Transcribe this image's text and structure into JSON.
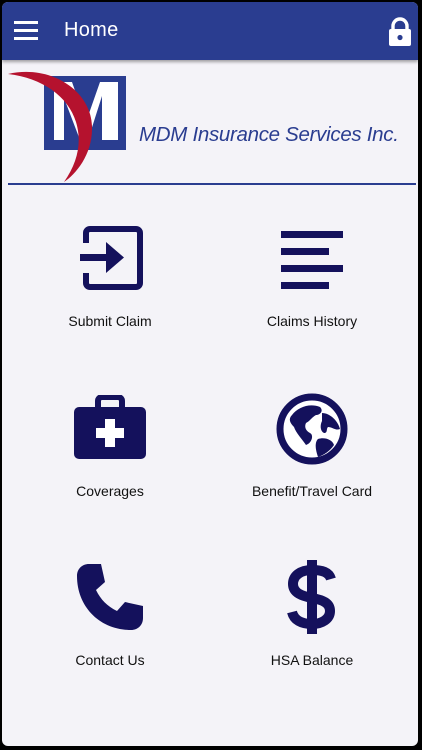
{
  "appbar": {
    "title": "Home",
    "menu_icon": "hamburger-menu-icon",
    "lock_icon": "lock-icon"
  },
  "header": {
    "company_name": "MDM Insurance Services Inc.",
    "logo_letter": "M",
    "logo_colors": {
      "mark": "#2a3d90",
      "swoosh": "#b5122e"
    }
  },
  "tiles": [
    {
      "label": "Submit Claim",
      "icon": "submit-claim-icon"
    },
    {
      "label": "Claims History",
      "icon": "list-icon"
    },
    {
      "label": "Coverages",
      "icon": "medical-kit-icon"
    },
    {
      "label": "Benefit/Travel Card",
      "icon": "globe-icon"
    },
    {
      "label": "Contact Us",
      "icon": "phone-icon"
    },
    {
      "label": "HSA Balance",
      "icon": "dollar-icon"
    }
  ],
  "colors": {
    "primary": "#2a3d90",
    "icon": "#14115c",
    "background": "#f4f3f8"
  }
}
